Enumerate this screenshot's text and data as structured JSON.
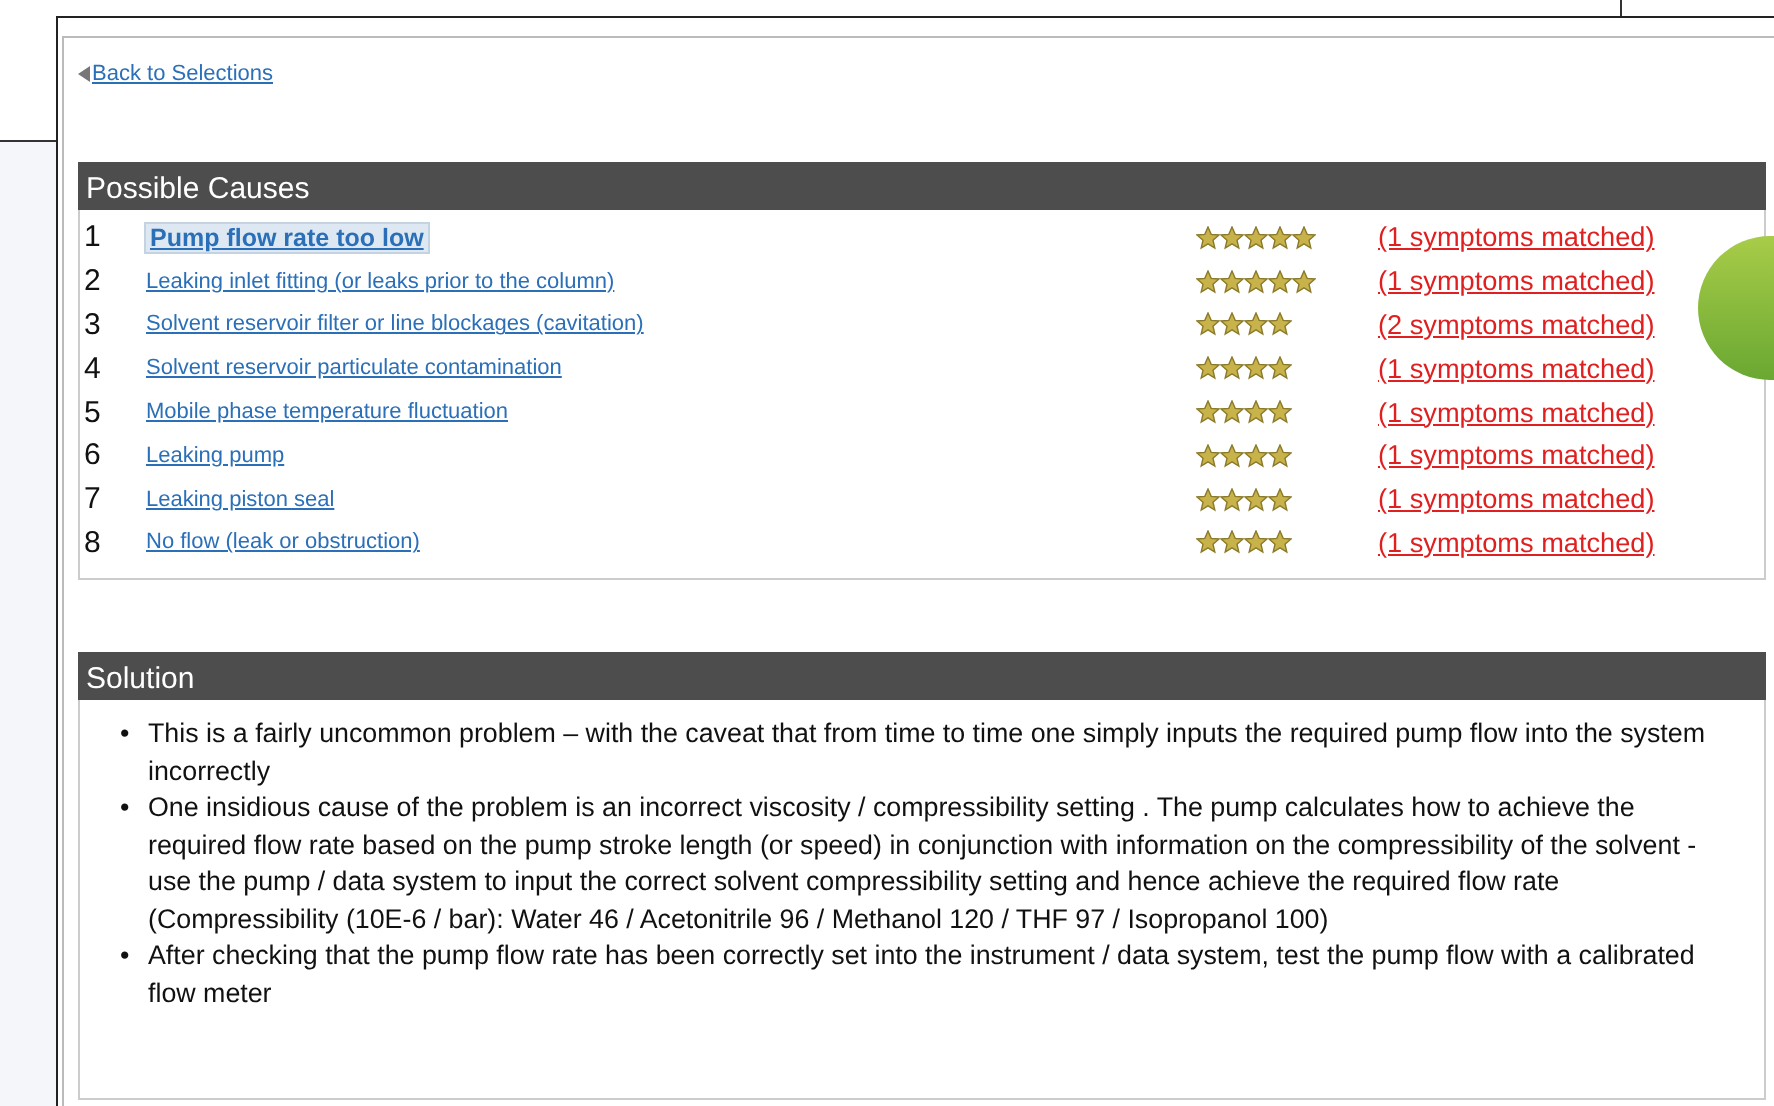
{
  "back_link": "Back to Selections",
  "causes": {
    "title": "Possible Causes",
    "rows": [
      {
        "number": "1",
        "cause": "Pump flow rate too low",
        "selected": true,
        "stars": 5,
        "matched": "(1 symptoms matched)"
      },
      {
        "number": "2",
        "cause": "Leaking inlet fitting (or leaks prior to the column)",
        "selected": false,
        "stars": 5,
        "matched": "(1 symptoms matched)"
      },
      {
        "number": "3",
        "cause": "Solvent reservoir filter or line blockages (cavitation)",
        "selected": false,
        "stars": 4,
        "matched": "(2 symptoms matched)"
      },
      {
        "number": "4",
        "cause": "Solvent reservoir particulate contamination",
        "selected": false,
        "stars": 4,
        "matched": "(1 symptoms matched)"
      },
      {
        "number": "5",
        "cause": "Mobile phase temperature fluctuation",
        "selected": false,
        "stars": 4,
        "matched": "(1 symptoms matched)"
      },
      {
        "number": "6",
        "cause": "Leaking pump",
        "selected": false,
        "stars": 4,
        "matched": "(1 symptoms matched)"
      },
      {
        "number": "7",
        "cause": "Leaking piston seal",
        "selected": false,
        "stars": 4,
        "matched": "(1 symptoms matched)"
      },
      {
        "number": "8",
        "cause": "No flow (leak or obstruction)",
        "selected": false,
        "stars": 4,
        "matched": "(1 symptoms matched)"
      }
    ]
  },
  "solution": {
    "title": "Solution",
    "bullet": "•",
    "items": [
      "This is a fairly uncommon problem – with the caveat that from time to time one simply inputs the required pump flow into the system incorrectly",
      "One insidious cause of the problem is an incorrect viscosity / compressibility setting . The pump calculates how to achieve the required flow rate based on the pump stroke length (or speed) in conjunction with information on the compressibility of the solvent - use the pump / data system to input the correct solvent compressibility setting and hence achieve the required flow rate (Compressibility (10E-6 / bar): Water 46 / Acetonitrile 96 / Methanol 120 / THF 97 / Isopropanol 100)",
      "After checking that the pump flow rate has been correctly set into the instrument / data system, test the pump flow with a calibrated flow meter"
    ]
  }
}
